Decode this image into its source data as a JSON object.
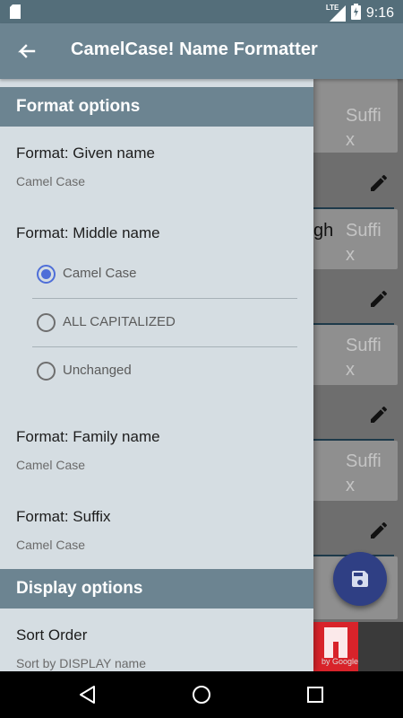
{
  "status_bar": {
    "network": "LTE",
    "time": "9:16"
  },
  "app_bar": {
    "title": "CamelCase! Name Formatter"
  },
  "background": {
    "suffix_placeholder": "Suffi",
    "suffix_x": "x",
    "partial_text": "gh"
  },
  "drawer": {
    "format_section": {
      "header": "Format options"
    },
    "given_name": {
      "title": "Format: Given name",
      "summary": "Camel Case"
    },
    "middle_name": {
      "title": "Format: Middle name",
      "options": [
        {
          "label": "Camel Case",
          "checked": true
        },
        {
          "label": "ALL CAPITALIZED",
          "checked": false
        },
        {
          "label": "Unchanged",
          "checked": false
        }
      ]
    },
    "family_name": {
      "title": "Format: Family name",
      "summary": "Camel Case"
    },
    "suffix": {
      "title": "Format: Suffix",
      "summary": "Camel Case"
    },
    "display_section": {
      "header": "Display options"
    },
    "sort_order": {
      "title": "Sort Order",
      "summary": "Sort by DISPLAY name"
    }
  },
  "ad": {
    "text": "by Google"
  },
  "colors": {
    "accent": "#4e6ed8",
    "app_bar": "#6c8491",
    "drawer_bg": "#d5dde2",
    "fab": "#2f3f84"
  }
}
